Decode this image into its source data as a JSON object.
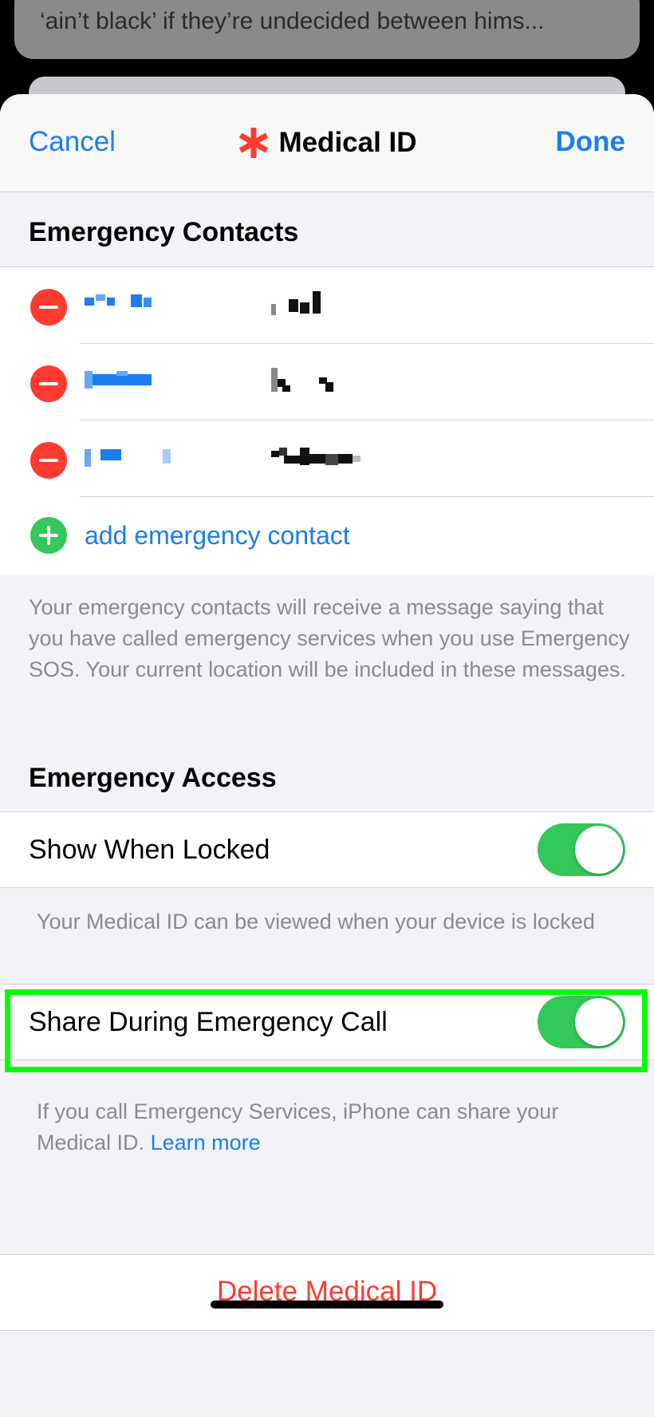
{
  "background_notification": {
    "line1": "‘ain’t black’ if they’re undecided between hims..."
  },
  "navbar": {
    "cancel_label": "Cancel",
    "title": "Medical ID",
    "done_label": "Done"
  },
  "emergency_contacts": {
    "header": "Emergency Contacts",
    "add_label": "add emergency contact",
    "footnote": "Your emergency contacts will receive a message saying that you have called emergency services when you use Emergency SOS. Your current location will be included in these messages."
  },
  "emergency_access": {
    "header": "Emergency Access",
    "show_when_locked": {
      "label": "Show When Locked",
      "on": true,
      "footnote": "Your Medical ID can be viewed when your device is locked"
    },
    "share_during_call": {
      "label": "Share During Emergency Call",
      "on": true,
      "footnote": "If you call Emergency Services, iPhone can share your Medical ID.",
      "link": "Learn more"
    }
  },
  "delete_label": "Delete Medical ID",
  "colors": {
    "accent": "#1a7ef0",
    "destructive": "#ff3b30",
    "toggle_on": "#34c759",
    "highlight": "#00ff00"
  }
}
